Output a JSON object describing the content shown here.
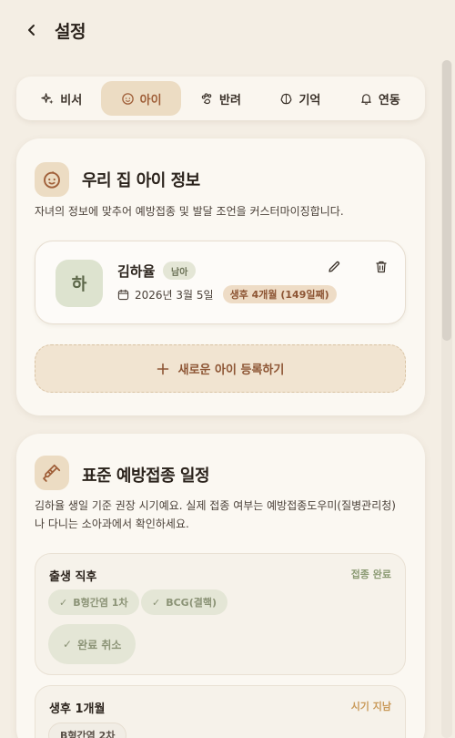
{
  "header": {
    "title": "설정"
  },
  "tabs": [
    {
      "label": "비서",
      "icon": "sparkle-icon",
      "active": false
    },
    {
      "label": "아이",
      "icon": "baby-icon",
      "active": true
    },
    {
      "label": "반려",
      "icon": "paw-icon",
      "active": false
    },
    {
      "label": "기억",
      "icon": "brain-icon",
      "active": false
    },
    {
      "label": "연동",
      "icon": "bell-icon",
      "active": false
    }
  ],
  "child_section": {
    "title": "우리 집 아이 정보",
    "description": "자녀의 정보에 맞추어 예방접종 및 발달 조언을 커스터마이징합니다.",
    "child": {
      "initial": "하",
      "name": "김하율",
      "gender": "남아",
      "birth_date": "2026년 3월 5일",
      "age": "생후 4개월 (149일째)"
    },
    "add_label": "새로운 아이 등록하기"
  },
  "vaccine_section": {
    "title": "표준 예방접종 일정",
    "description": "김하율 생일 기준 권장 시기예요. 실제 접종 여부는 예방접종도우미(질병관리청) 나 다니는 소아과에서 확인하세요.",
    "groups": [
      {
        "title": "출생 직후",
        "status": "접종 완료",
        "chips": [
          "B형간염 1차",
          "BCG(결핵)"
        ],
        "cancel_label": "완료 취소"
      },
      {
        "title": "생후 1개월",
        "status": "시기 지남",
        "chips": [
          "B형간염 2차"
        ]
      }
    ]
  },
  "colors": {
    "accent": "#a0603a",
    "background": "#f4eee4",
    "done": "#8b9a73",
    "late": "#c99a5a"
  }
}
